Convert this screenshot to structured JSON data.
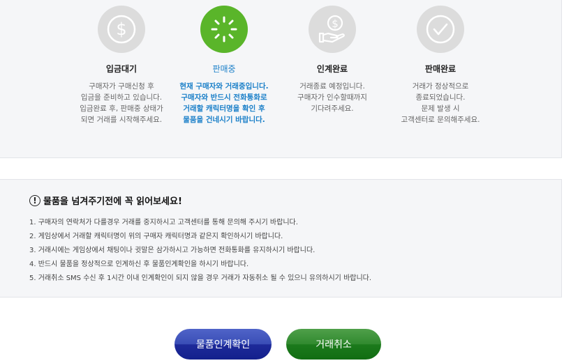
{
  "steps": [
    {
      "icon": "dollar-icon",
      "title": "입금대기",
      "desc": "구매자가 구매신청 후\n입금을 준비하고 있습니다.\n입금완료 후, 판매중 상태가\n되면 거래를 시작해주세요."
    },
    {
      "icon": "loading-icon",
      "title": "판매중",
      "desc": "현재 구매자와 거래중입니다.\n구매자와 반드시 전화통화로\n거래할 캐릭터명을 확인 후\n물품을 건네시기 바랍니다."
    },
    {
      "icon": "hand-coin-icon",
      "title": "인계완료",
      "desc": "거래종료 예정입니다.\n구매자가 인수할때까지\n기다려주세요."
    },
    {
      "icon": "check-icon",
      "title": "판매완료",
      "desc": "거래가 정상적으로\n종료되었습니다.\n문제 발생 시\n고객센터로 문의해주세요."
    }
  ],
  "notice": {
    "title": "물품을 넘겨주기전에 꼭 읽어보세요!",
    "items": [
      "1. 구매자의 연락처가 다를경우 거래를 중지하시고 고객센터를 통해 문의해 주시기 바랍니다.",
      "2. 게임상에서 거래할 캐릭터명이 위의 구매자 캐릭터명과 같은지 확인하시기 바랍니다.",
      "3. 거래시에는 게임상에서 채팅이나 귓말은 삼가하시고 가능하면 전화통화를 유지하시기 바랍니다.",
      "4. 반드시 물품을 정상적으로 인계하신 후 물품인계확인을 하시기 바랍니다.",
      "5. 거래취소 SMS 수신 후 1시간 이내 인계확인이 되지 않을 경우 거래가 자동취소 될 수 있으니 유의하시기 바랍니다."
    ]
  },
  "buttons": {
    "confirm": "물품인계확인",
    "cancel": "거래취소"
  },
  "colors": {
    "active_step": "#5ab52a",
    "inactive_step": "#dcdcdc",
    "active_text": "#1a7fc8",
    "confirm_button": "#1e2a9a",
    "cancel_button": "#1c7a1c"
  }
}
